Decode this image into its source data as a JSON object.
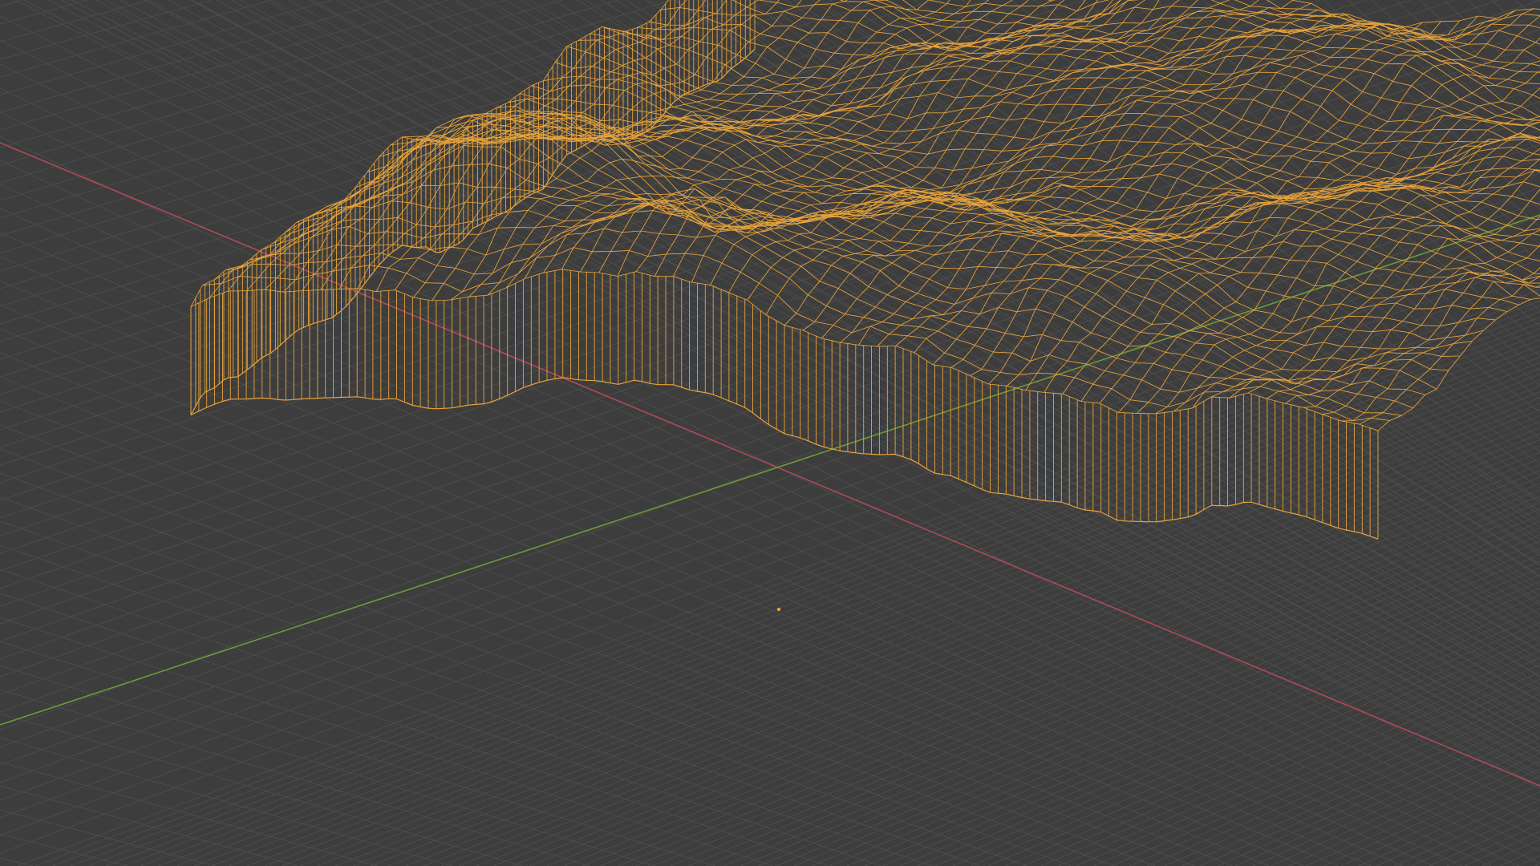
{
  "viewport": {
    "background": "#3d3d3d",
    "grid_color": "#4c4c4c",
    "x_axis_color": "#b04a58",
    "y_axis_color": "#6e9a3a",
    "wire_color": "#e8a33a",
    "origin_marker_color": "#e8a33a"
  },
  "scene": {
    "object": "terrain-mesh",
    "display_mode": "wireframe",
    "selected": true
  }
}
